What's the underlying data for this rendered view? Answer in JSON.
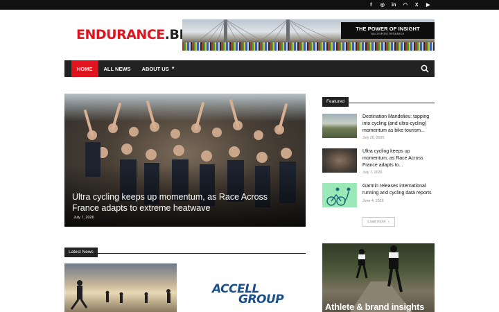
{
  "site": {
    "logo_main": "ENDURANCE",
    "logo_suffix": ".BIZ"
  },
  "social_icons": [
    "facebook-icon",
    "instagram-icon",
    "linkedin-icon",
    "rss-icon",
    "x-icon",
    "youtube-icon"
  ],
  "social_glyphs": [
    "f",
    "◎",
    "in",
    "◠",
    "X",
    "▶"
  ],
  "banner": {
    "headline": "THE POWER OF INSIGHT",
    "subline": "MULTISPORT RESEARCH"
  },
  "nav": {
    "items": [
      {
        "label": "HOME",
        "active": true
      },
      {
        "label": "ALL NEWS",
        "active": false
      },
      {
        "label": "ABOUT US",
        "active": false,
        "dropdown": true
      }
    ]
  },
  "hero": {
    "title": "Ultra cycling keeps up momentum, as Race Across France adapts to extreme heatwave",
    "date": "July 7, 2026"
  },
  "featured": {
    "heading": "Featured",
    "items": [
      {
        "title": "Destination Mandelieu: tapping into cycling (and ultra-cycling) momentum as bike tourism...",
        "date": "July 20, 2026"
      },
      {
        "title": "Ultra cycling keeps up momentum, as Race Across France adapts to...",
        "date": "July 7, 2026"
      },
      {
        "title": "Garmin releases international running and cycling data reports",
        "date": "June 4, 2026"
      }
    ],
    "load_more": "Load more"
  },
  "latest": {
    "heading": "Latest News",
    "logo_line1": "ACCELL",
    "logo_line2": "GROUP"
  },
  "side_ad": {
    "text": "Athlete & brand insights"
  },
  "colors": {
    "brand_red": "#e0141e",
    "nav_bg": "#222222",
    "topbar_bg": "#111111",
    "accell_blue": "#1a4f8c"
  }
}
